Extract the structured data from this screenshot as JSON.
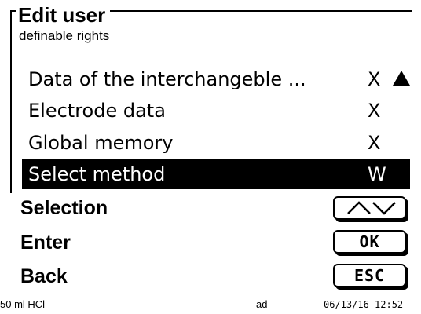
{
  "header": {
    "title": "Edit user",
    "subtitle": "definable rights"
  },
  "list": {
    "items": [
      {
        "label": "Data of the interchangeble ...",
        "value": "X",
        "selected": false
      },
      {
        "label": "Electrode data",
        "value": "X",
        "selected": false
      },
      {
        "label": "Global memory",
        "value": "X",
        "selected": false
      },
      {
        "label": "Select method",
        "value": "W",
        "selected": true
      }
    ],
    "scroll_icons": [
      "triangle-up-icon",
      "triangle-down-icon"
    ]
  },
  "softkeys": [
    {
      "label": "Selection",
      "button": "",
      "button_icon": "up-down-arrows-icon"
    },
    {
      "label": "Enter",
      "button": "OK"
    },
    {
      "label": "Back",
      "button": "ESC"
    }
  ],
  "status_bar": {
    "left": "50 ml HCl",
    "center": "ad",
    "right": "06/13/16 12:52"
  },
  "colors": {
    "foreground": "#000000",
    "background": "#ffffff",
    "selection_background": "#000000",
    "selection_text": "#ffffff"
  }
}
